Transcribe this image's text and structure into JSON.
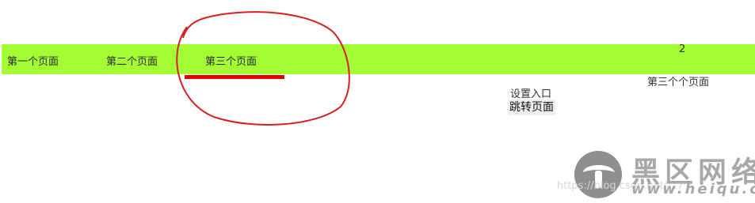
{
  "nav": {
    "tabs": [
      {
        "label": "第一个页面"
      },
      {
        "label": "第二个页面"
      },
      {
        "label": "第三个页面"
      }
    ],
    "counter": "2"
  },
  "content": {
    "page_label": "第三个个页面",
    "settings_entry": "设置入口",
    "jump_button": "跳转页面"
  },
  "watermark": {
    "brand": "黑区网络",
    "url": "www.heiqu.com",
    "faint": "https://blog.csdn.net/...7"
  },
  "colors": {
    "navbar": "#a3fc34",
    "annotation": "#e00000"
  }
}
